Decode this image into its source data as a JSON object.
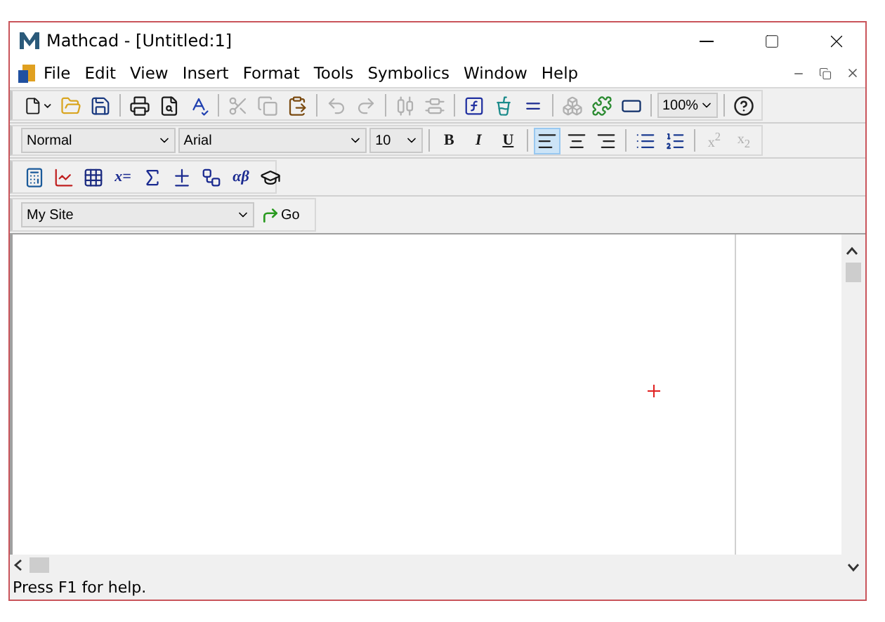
{
  "window": {
    "title": "Mathcad - [Untitled:1]"
  },
  "menu": [
    "File",
    "Edit",
    "View",
    "Insert",
    "Format",
    "Tools",
    "Symbolics",
    "Window",
    "Help"
  ],
  "standard_toolbar": {
    "buttons": [
      {
        "disabled": false
      },
      {
        "disabled": false
      },
      {
        "disabled": false
      },
      {
        "disabled": false
      },
      {
        "disabled": false
      },
      {
        "disabled": false
      },
      {
        "disabled": true
      },
      {
        "disabled": true
      },
      {
        "disabled": false
      },
      {
        "disabled": true
      },
      {
        "disabled": true
      },
      {
        "disabled": true
      },
      {
        "disabled": true
      },
      {
        "disabled": false
      },
      {
        "disabled": false
      },
      {
        "disabled": false
      },
      {
        "disabled": true
      },
      {
        "disabled": false
      },
      {
        "disabled": false
      }
    ],
    "zoom": "100%"
  },
  "format_toolbar": {
    "style": "Normal",
    "font": "Arial",
    "size": "10",
    "text_buttons": [
      {
        "label": "B"
      },
      {
        "label": "I"
      },
      {
        "label": "U"
      }
    ],
    "align_buttons": [
      {
        "selected": true
      },
      {
        "selected": false
      },
      {
        "selected": false
      }
    ],
    "script_buttons": [
      {
        "label": "x$^{2}$",
        "disabled": true
      },
      {
        "label": "x$_{2}$",
        "disabled": true
      }
    ]
  },
  "math_toolbar": {
    "labels": [
      "x=",
      "αβ"
    ]
  },
  "resource_toolbar": {
    "site": "My Site",
    "go": "Go"
  },
  "status_bar": {
    "text": "Press F1 for help."
  }
}
